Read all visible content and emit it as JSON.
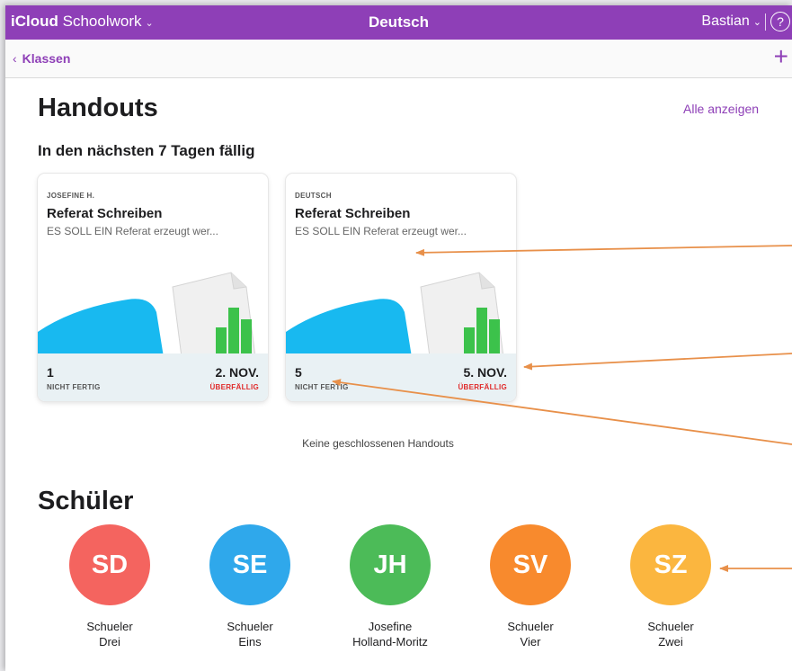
{
  "topbar": {
    "app_brand": "iCloud",
    "app_name": "Schoolwork",
    "class_name": "Deutsch",
    "user": "Bastian",
    "help_label": "?"
  },
  "navbar": {
    "back_label": "Klassen",
    "add_label": "+"
  },
  "handouts": {
    "heading": "Handouts",
    "see_all": "Alle anzeigen",
    "due_heading": "In den nächsten 7 Tagen fällig",
    "empty_closed": "Keine geschlossenen Handouts",
    "cards": [
      {
        "subtitle": "JOSEFINE H.",
        "title": "Referat Schreiben",
        "description": "ES SOLL EIN Referat erzeugt wer...",
        "count": "1",
        "count_label": "NICHT FERTIG",
        "due_date": "2. NOV.",
        "status": "ÜBERFÄLLIG"
      },
      {
        "subtitle": "DEUTSCH",
        "title": "Referat Schreiben",
        "description": "ES SOLL EIN Referat erzeugt wer...",
        "count": "5",
        "count_label": "NICHT FERTIG",
        "due_date": "5. NOV.",
        "status": "ÜBERFÄLLIG"
      }
    ]
  },
  "students": {
    "heading": "Schüler",
    "items": [
      {
        "initials": "SD",
        "first": "Schueler",
        "last": "Drei",
        "color": "#f4645f"
      },
      {
        "initials": "SE",
        "first": "Schueler",
        "last": "Eins",
        "color": "#2fa8eb"
      },
      {
        "initials": "JH",
        "first": "Josefine",
        "last": "Holland-Moritz",
        "color": "#4cbb58"
      },
      {
        "initials": "SV",
        "first": "Schueler",
        "last": "Vier",
        "color": "#f88a2d"
      },
      {
        "initials": "SZ",
        "first": "Schueler",
        "last": "Zwei",
        "color": "#fbb63f"
      }
    ]
  },
  "colors": {
    "accent": "#8e3fb7",
    "overdue": "#e02a2a",
    "annotation_arrow": "#e8904a"
  }
}
